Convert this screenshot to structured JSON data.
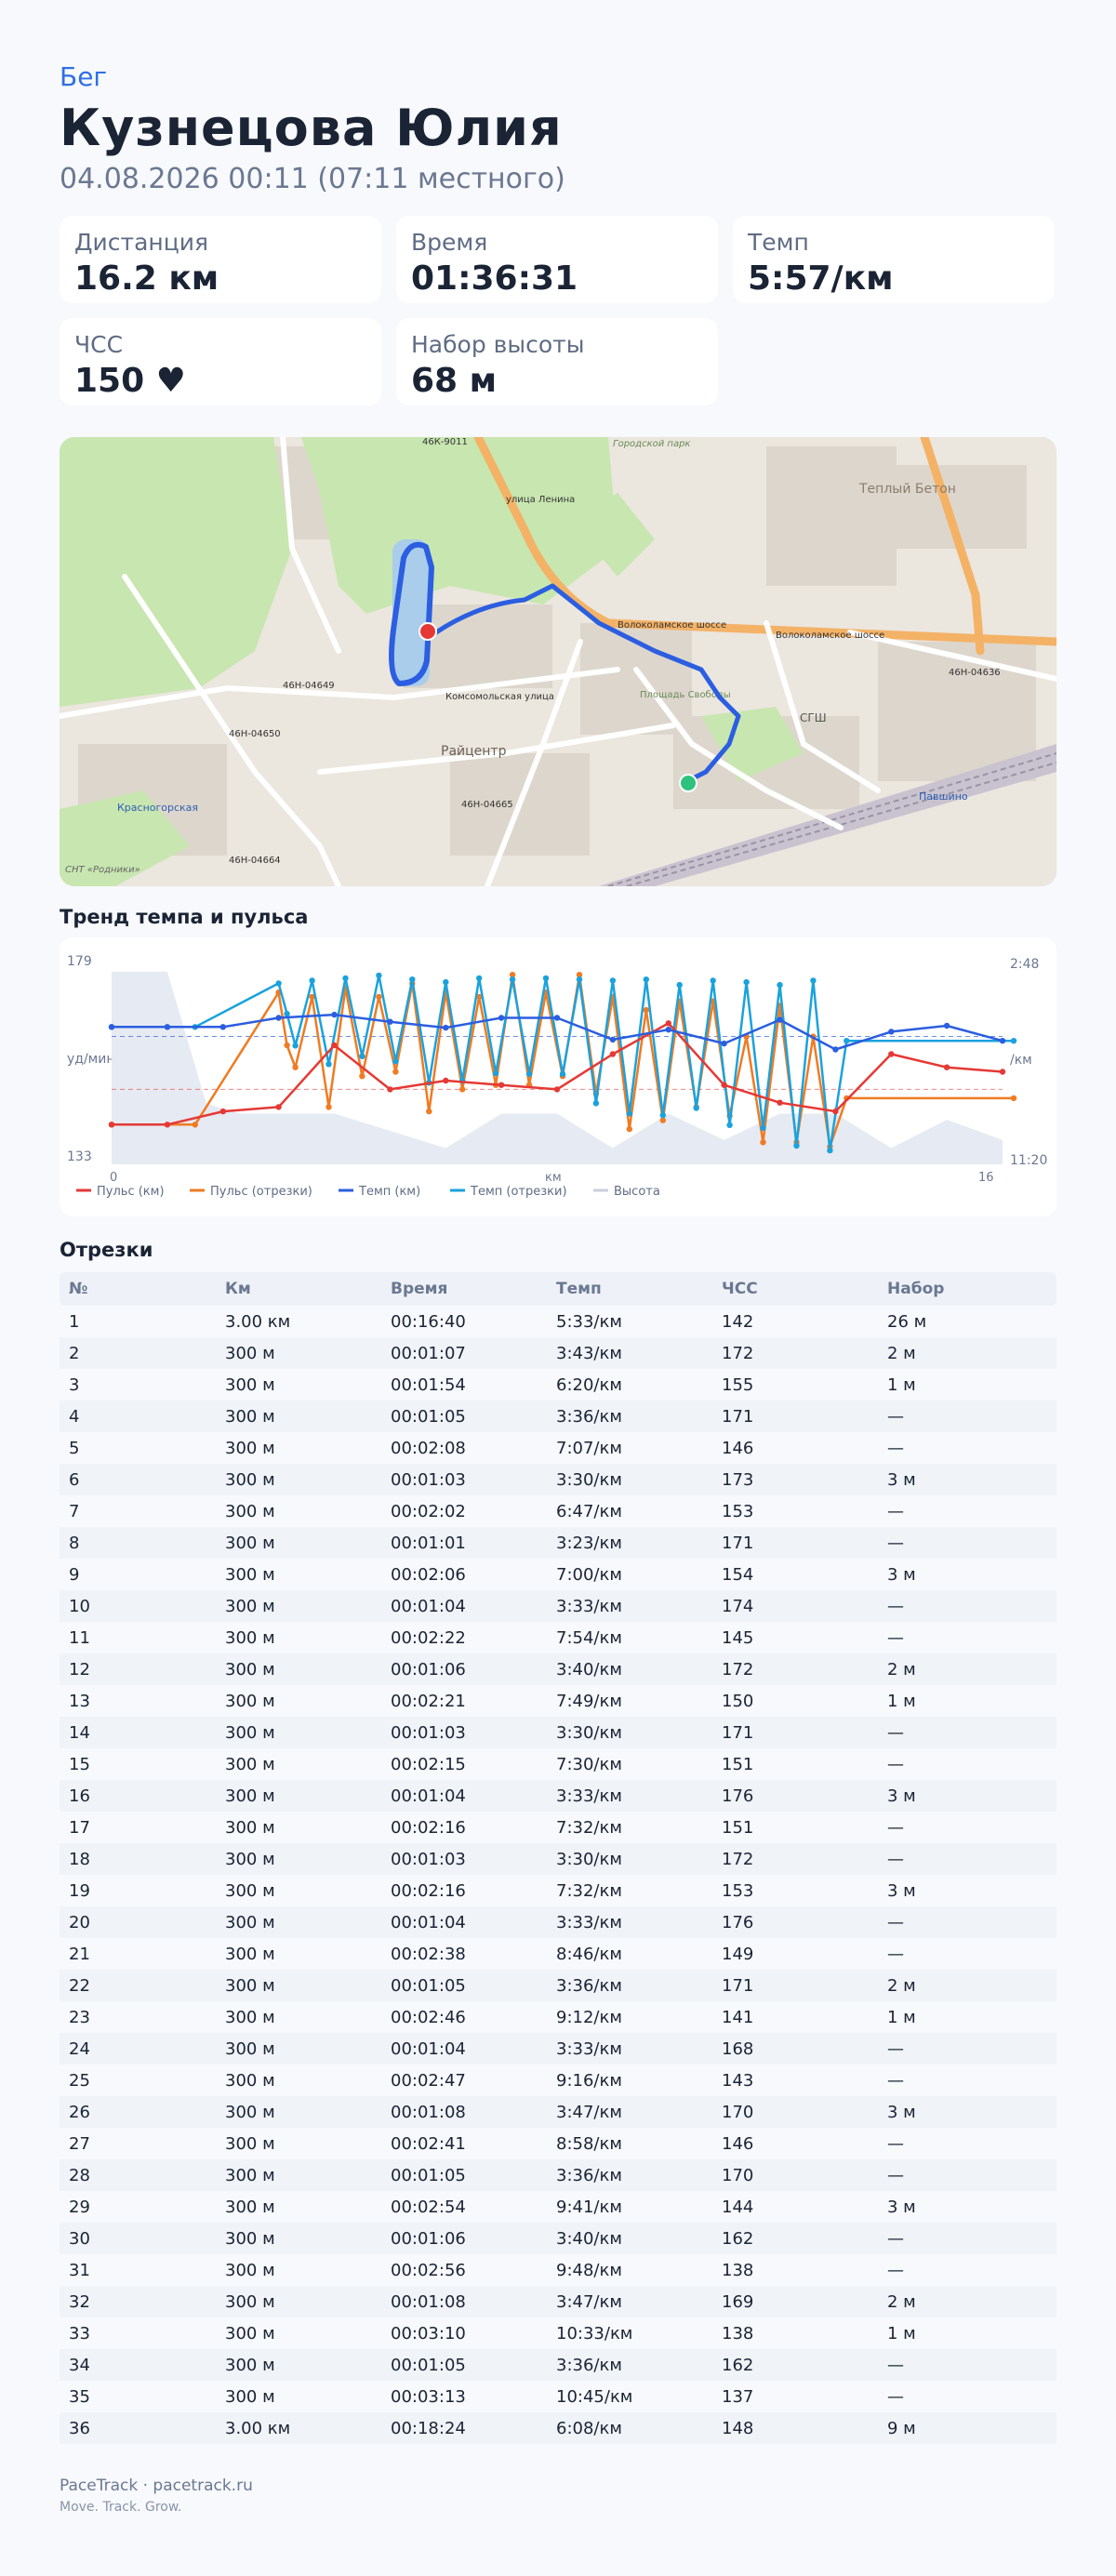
{
  "header": {
    "sport": "Бег",
    "athlete": "Кузнецова Юлия",
    "datetime": "04.08.2026 00:11 (07:11 местного)"
  },
  "stats": [
    {
      "label": "Дистанция",
      "value": "16.2 км"
    },
    {
      "label": "Время",
      "value": "01:36:31"
    },
    {
      "label": "Темп",
      "value": "5:57/км"
    },
    {
      "label": "ЧСС",
      "value": "150 ♥"
    },
    {
      "label": "Набор высоты",
      "value": "68 м"
    }
  ],
  "map": {
    "labels": [
      "46К-9011",
      "Городской парк",
      "Теплый Бетон",
      "улица Ленина",
      "Волоколамское шоссе",
      "Волоколамское шоссе",
      "46Н-04649",
      "46Н-04650",
      "Комсомольская улица",
      "Райцентр",
      "46Н-04665",
      "46Н-04636",
      "СГШ",
      "Павшино",
      "Красногорская",
      "СНТ «Родники»",
      "46Н-04664",
      "Площадь Свободы"
    ],
    "colors": {
      "route": "#2b5ee0",
      "start": "#2ec27e",
      "finish": "#e53935",
      "park": "#c8e6b0",
      "road_major": "#f4b266"
    }
  },
  "chart": {
    "title": "Тренд темпа и пульса",
    "left_top": "179",
    "left_bottom": "133",
    "left_label": "уд/мин",
    "right_top": "2:48",
    "right_bottom": "11:20",
    "right_label": "/км",
    "x_start": "0",
    "x_end": "16",
    "x_label": "км",
    "legend": [
      "Пульс (км)",
      "Пульс (отрезки)",
      "Темп (км)",
      "Темп (отрезки)",
      "Высота"
    ],
    "colors": {
      "hr_km": "#e53935",
      "hr_seg": "#f07b22",
      "pace_km": "#2b5ee0",
      "pace_seg": "#1ba2dc",
      "elevation": "#d5dbe6"
    }
  },
  "chart_data": {
    "type": "line",
    "title": "Тренд темпа и пульса",
    "xlabel": "км",
    "ylabel": "уд/мин",
    "y2label": "/км",
    "xlim": [
      0,
      16
    ],
    "ylim": [
      133,
      179
    ],
    "y2lim": [
      "2:48",
      "11:20"
    ],
    "series": [
      {
        "name": "Пульс (отрезки)",
        "axis": "left",
        "x": [
          0,
          1.5,
          3,
          3.15,
          3.3,
          3.6,
          3.9,
          4.2,
          4.5,
          4.8,
          5.1,
          5.4,
          5.7,
          6.0,
          6.3,
          6.6,
          6.9,
          7.2,
          7.5,
          7.8,
          8.1,
          8.4,
          8.7,
          9.0,
          9.3,
          9.6,
          9.9,
          10.2,
          10.5,
          10.8,
          11.1,
          11.4,
          11.7,
          12.0,
          12.3,
          12.6,
          12.9,
          13.2,
          16.2
        ],
        "y": [
          142,
          142,
          172,
          160,
          155,
          171,
          146,
          173,
          153,
          171,
          154,
          174,
          145,
          172,
          150,
          171,
          151,
          176,
          151,
          172,
          153,
          176,
          149,
          171,
          141,
          168,
          143,
          170,
          146,
          170,
          144,
          162,
          138,
          169,
          138,
          162,
          137,
          148,
          148
        ]
      },
      {
        "name": "Темп (отрезки)",
        "axis": "right",
        "x": [
          0,
          1.5,
          3,
          3.15,
          3.3,
          3.6,
          3.9,
          4.2,
          4.5,
          4.8,
          5.1,
          5.4,
          5.7,
          6.0,
          6.3,
          6.6,
          6.9,
          7.2,
          7.5,
          7.8,
          8.1,
          8.4,
          8.7,
          9.0,
          9.3,
          9.6,
          9.9,
          10.2,
          10.5,
          10.8,
          11.1,
          11.4,
          11.7,
          12.0,
          12.3,
          12.6,
          12.9,
          13.2,
          16.2
        ],
        "y": [
          "5:33",
          "5:33",
          "3:43",
          "5:00",
          "6:20",
          "3:36",
          "7:07",
          "3:30",
          "6:47",
          "3:23",
          "7:00",
          "3:33",
          "7:54",
          "3:40",
          "7:49",
          "3:30",
          "7:30",
          "3:33",
          "7:32",
          "3:30",
          "7:32",
          "3:33",
          "8:46",
          "3:36",
          "9:12",
          "3:33",
          "9:16",
          "3:47",
          "8:58",
          "3:36",
          "9:41",
          "3:40",
          "9:48",
          "3:47",
          "10:33",
          "3:36",
          "10:45",
          "6:08",
          "6:08"
        ]
      },
      {
        "name": "Пульс (км)",
        "axis": "left",
        "x": [
          0,
          1,
          2,
          3,
          4,
          5,
          6,
          7,
          8,
          9,
          10,
          11,
          12,
          13,
          14,
          15,
          16
        ],
        "y": [
          142,
          142,
          145,
          146,
          160,
          150,
          152,
          151,
          150,
          158,
          165,
          151,
          147,
          145,
          158,
          155,
          154
        ]
      },
      {
        "name": "Темп (км)",
        "axis": "right",
        "x": [
          0,
          1,
          2,
          3,
          4,
          5,
          6,
          7,
          8,
          9,
          10,
          11,
          12,
          13,
          14,
          15,
          16
        ],
        "y": [
          "5:33",
          "5:33",
          "5:33",
          "5:10",
          "5:02",
          "5:20",
          "5:35",
          "5:10",
          "5:10",
          "6:05",
          "5:40",
          "6:15",
          "5:15",
          "6:30",
          "5:45",
          "5:30",
          "6:08"
        ]
      },
      {
        "name": "Высота",
        "axis": "none",
        "x": [
          0,
          1,
          1.7,
          2.3,
          3,
          4,
          6,
          7,
          8,
          9,
          10,
          11,
          12,
          13,
          14,
          15,
          16
        ],
        "y": [
          0.95,
          0.95,
          0.3,
          0.25,
          0.25,
          0.25,
          0.08,
          0.25,
          0.25,
          0.08,
          0.25,
          0.12,
          0.25,
          0.25,
          0.08,
          0.22,
          0.12
        ]
      }
    ]
  },
  "segments": {
    "title": "Отрезки",
    "headers": [
      "№",
      "Км",
      "Время",
      "Темп",
      "ЧСС",
      "Набор"
    ],
    "rows": [
      [
        "1",
        "3.00 км",
        "00:16:40",
        "5:33/км",
        "142",
        "26 м"
      ],
      [
        "2",
        "300 м",
        "00:01:07",
        "3:43/км",
        "172",
        "2 м"
      ],
      [
        "3",
        "300 м",
        "00:01:54",
        "6:20/км",
        "155",
        "1 м"
      ],
      [
        "4",
        "300 м",
        "00:01:05",
        "3:36/км",
        "171",
        "—"
      ],
      [
        "5",
        "300 м",
        "00:02:08",
        "7:07/км",
        "146",
        "—"
      ],
      [
        "6",
        "300 м",
        "00:01:03",
        "3:30/км",
        "173",
        "3 м"
      ],
      [
        "7",
        "300 м",
        "00:02:02",
        "6:47/км",
        "153",
        "—"
      ],
      [
        "8",
        "300 м",
        "00:01:01",
        "3:23/км",
        "171",
        "—"
      ],
      [
        "9",
        "300 м",
        "00:02:06",
        "7:00/км",
        "154",
        "3 м"
      ],
      [
        "10",
        "300 м",
        "00:01:04",
        "3:33/км",
        "174",
        "—"
      ],
      [
        "11",
        "300 м",
        "00:02:22",
        "7:54/км",
        "145",
        "—"
      ],
      [
        "12",
        "300 м",
        "00:01:06",
        "3:40/км",
        "172",
        "2 м"
      ],
      [
        "13",
        "300 м",
        "00:02:21",
        "7:49/км",
        "150",
        "1 м"
      ],
      [
        "14",
        "300 м",
        "00:01:03",
        "3:30/км",
        "171",
        "—"
      ],
      [
        "15",
        "300 м",
        "00:02:15",
        "7:30/км",
        "151",
        "—"
      ],
      [
        "16",
        "300 м",
        "00:01:04",
        "3:33/км",
        "176",
        "3 м"
      ],
      [
        "17",
        "300 м",
        "00:02:16",
        "7:32/км",
        "151",
        "—"
      ],
      [
        "18",
        "300 м",
        "00:01:03",
        "3:30/км",
        "172",
        "—"
      ],
      [
        "19",
        "300 м",
        "00:02:16",
        "7:32/км",
        "153",
        "3 м"
      ],
      [
        "20",
        "300 м",
        "00:01:04",
        "3:33/км",
        "176",
        "—"
      ],
      [
        "21",
        "300 м",
        "00:02:38",
        "8:46/км",
        "149",
        "—"
      ],
      [
        "22",
        "300 м",
        "00:01:05",
        "3:36/км",
        "171",
        "2 м"
      ],
      [
        "23",
        "300 м",
        "00:02:46",
        "9:12/км",
        "141",
        "1 м"
      ],
      [
        "24",
        "300 м",
        "00:01:04",
        "3:33/км",
        "168",
        "—"
      ],
      [
        "25",
        "300 м",
        "00:02:47",
        "9:16/км",
        "143",
        "—"
      ],
      [
        "26",
        "300 м",
        "00:01:08",
        "3:47/км",
        "170",
        "3 м"
      ],
      [
        "27",
        "300 м",
        "00:02:41",
        "8:58/км",
        "146",
        "—"
      ],
      [
        "28",
        "300 м",
        "00:01:05",
        "3:36/км",
        "170",
        "—"
      ],
      [
        "29",
        "300 м",
        "00:02:54",
        "9:41/км",
        "144",
        "3 м"
      ],
      [
        "30",
        "300 м",
        "00:01:06",
        "3:40/км",
        "162",
        "—"
      ],
      [
        "31",
        "300 м",
        "00:02:56",
        "9:48/км",
        "138",
        "—"
      ],
      [
        "32",
        "300 м",
        "00:01:08",
        "3:47/км",
        "169",
        "2 м"
      ],
      [
        "33",
        "300 м",
        "00:03:10",
        "10:33/км",
        "138",
        "1 м"
      ],
      [
        "34",
        "300 м",
        "00:01:05",
        "3:36/км",
        "162",
        "—"
      ],
      [
        "35",
        "300 м",
        "00:03:13",
        "10:45/км",
        "137",
        "—"
      ],
      [
        "36",
        "3.00 км",
        "00:18:24",
        "6:08/км",
        "148",
        "9 м"
      ]
    ]
  },
  "footer": {
    "brand": "PaceTrack · pacetrack.ru",
    "tagline": "Move. Track. Grow."
  }
}
